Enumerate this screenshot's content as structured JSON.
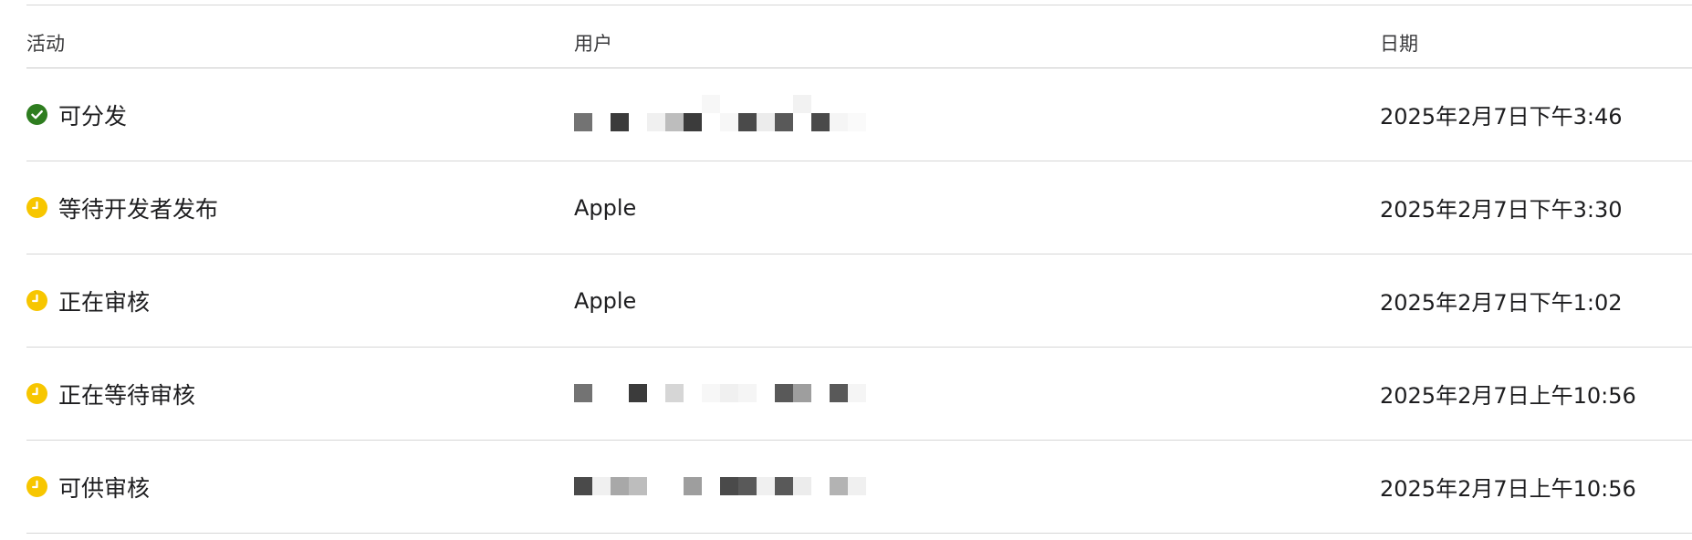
{
  "colors": {
    "success": "#2e7d1f",
    "pending": "#f7c600",
    "divider": "#d6d6d6",
    "text": "#1d1d1f"
  },
  "table": {
    "headers": {
      "activity": "活动",
      "user": "用户",
      "date": "日期"
    },
    "rows": [
      {
        "status_icon": "checkmark-circle-icon",
        "activity": "可分发",
        "user": "",
        "user_redacted": true,
        "date": "2025年2月7日下午3:46"
      },
      {
        "status_icon": "clock-icon",
        "activity": "等待开发者发布",
        "user": "Apple",
        "user_redacted": false,
        "date": "2025年2月7日下午3:30"
      },
      {
        "status_icon": "clock-icon",
        "activity": "正在审核",
        "user": "Apple",
        "user_redacted": false,
        "date": "2025年2月7日下午1:02"
      },
      {
        "status_icon": "clock-icon",
        "activity": "正在等待审核",
        "user": "",
        "user_redacted": true,
        "date": "2025年2月7日上午10:56"
      },
      {
        "status_icon": "clock-icon",
        "activity": "可供审核",
        "user": "",
        "user_redacted": true,
        "date": "2025年2月7日上午10:56"
      }
    ]
  }
}
